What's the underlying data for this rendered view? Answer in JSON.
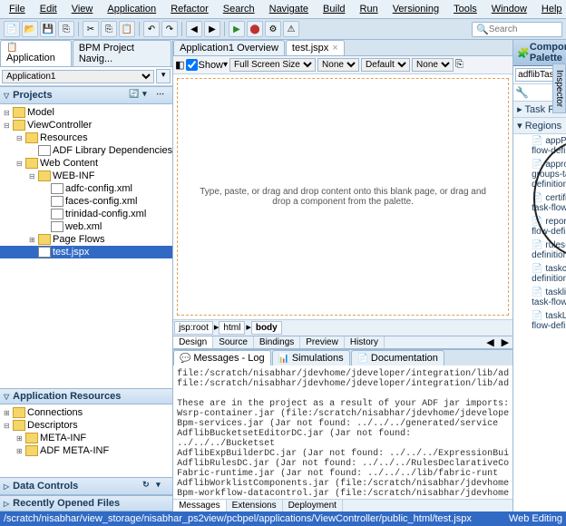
{
  "menu": [
    "File",
    "Edit",
    "View",
    "Application",
    "Refactor",
    "Search",
    "Navigate",
    "Build",
    "Run",
    "Versioning",
    "Tools",
    "Window",
    "Help"
  ],
  "search_placeholder": "Search",
  "left": {
    "tabs": [
      "Application",
      "BPM Project Navig..."
    ],
    "app_selector": "Application1",
    "sections": {
      "projects": "Projects",
      "app_res": "Application Resources",
      "data_ctl": "Data Controls",
      "recent": "Recently Opened Files"
    },
    "tree": [
      {
        "d": 0,
        "exp": "⊟",
        "icon": "fld",
        "label": "Model"
      },
      {
        "d": 0,
        "exp": "⊟",
        "icon": "fld",
        "label": "ViewController"
      },
      {
        "d": 1,
        "exp": "⊟",
        "icon": "fld",
        "label": "Resources"
      },
      {
        "d": 2,
        "exp": "",
        "icon": "file",
        "label": "ADF Library Dependencies"
      },
      {
        "d": 1,
        "exp": "⊟",
        "icon": "fld",
        "label": "Web Content"
      },
      {
        "d": 2,
        "exp": "⊟",
        "icon": "fld",
        "label": "WEB-INF"
      },
      {
        "d": 3,
        "exp": "",
        "icon": "file",
        "label": "adfc-config.xml"
      },
      {
        "d": 3,
        "exp": "",
        "icon": "file",
        "label": "faces-config.xml"
      },
      {
        "d": 3,
        "exp": "",
        "icon": "file",
        "label": "trinidad-config.xml"
      },
      {
        "d": 3,
        "exp": "",
        "icon": "file",
        "label": "web.xml"
      },
      {
        "d": 2,
        "exp": "⊞",
        "icon": "fld",
        "label": "Page Flows"
      },
      {
        "d": 2,
        "exp": "",
        "icon": "file",
        "label": "test.jspx",
        "selected": true
      }
    ],
    "app_res_tree": [
      {
        "d": 0,
        "exp": "⊞",
        "icon": "fld",
        "label": "Connections"
      },
      {
        "d": 0,
        "exp": "⊟",
        "icon": "fld",
        "label": "Descriptors"
      },
      {
        "d": 1,
        "exp": "⊞",
        "icon": "fld",
        "label": "META-INF"
      },
      {
        "d": 1,
        "exp": "⊞",
        "icon": "fld",
        "label": "ADF META-INF"
      }
    ]
  },
  "center": {
    "tabs": [
      {
        "label": "Application1 Overview",
        "active": false
      },
      {
        "label": "test.jspx",
        "active": true
      }
    ],
    "toolbar": {
      "show": "Show",
      "full": "Full Screen Size",
      "none1": "None",
      "default": "Default",
      "none2": "None"
    },
    "canvas_text": "Type, paste, or drag and drop content onto this blank\npage, or drag and drop a component from the palette.",
    "breadcrumb": [
      "jsp:root",
      "html",
      "body"
    ],
    "bottom_tabs": [
      "Design",
      "Source",
      "Bindings",
      "Preview",
      "History"
    ],
    "log": {
      "tabs": [
        "Messages - Log",
        "Simulations",
        "Documentation"
      ],
      "body": "file:/scratch/nisabhar/jdevhome/jdeveloper/integration/lib/ad\nfile:/scratch/nisabhar/jdevhome/jdeveloper/integration/lib/ad\n\nThese are in the project as a result of your ADF jar imports:\nWsrp-container.jar (file:/scratch/nisabhar/jdevhome/jdevelope\nBpm-services.jar (Jar not found: ../../../generated/service\nAdflibBucketsetEditorDC.jar (Jar not found: ../../../Bucketset\nAdflibExpBuilderDC.jar (Jar not found: ../../../ExpressionBui\nAdflibRulesDC.jar (Jar not found: ../../../RulesDeclarativeCo\nFabric-runtime.jar (Jar not found: ../../../lib/fabric-runt\nAdflibWorklistComponents.jar (file:/scratch/nisabhar/jdevhome\nBpm-workflow-datacontrol.jar (file:/scratch/nisabhar/jdevhome",
      "bottom_tabs": [
        "Messages",
        "Extensions",
        "Deployment"
      ]
    }
  },
  "palette": {
    "title": "Component Palette",
    "search_value": "adflibTaskListTaskFlow.jar",
    "sections": [
      "Task Flows",
      "Regions"
    ],
    "items": [
      "appPrefs-task-flow-definition",
      "approval-groups-task-flow-definition",
      "certificates-task-flow-definition",
      "reports-task-flow-definition",
      "rules-task-flow-definition",
      "taskconfig-flow-definition",
      "tasklist-reports-task-flow-definition",
      "taskList-task-flow-definition"
    ]
  },
  "status": {
    "path": "/scratch/nisabhar/view_storage/nisabhar_ps2view/pcbpel/applications/ViewController/public_html/test.jspx",
    "right": "Web Editing"
  },
  "side_tab": "Inspector"
}
